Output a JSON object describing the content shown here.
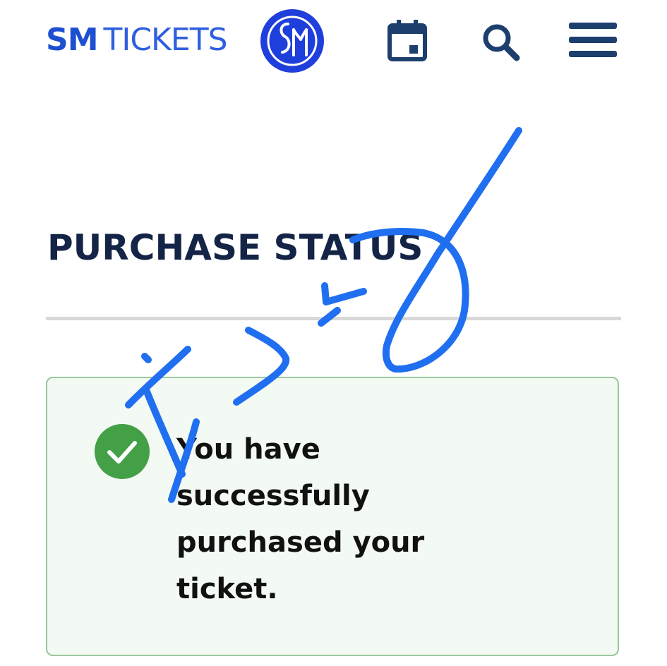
{
  "header": {
    "brand_bold": "SM",
    "brand_light": "TICKETS",
    "logo_icon": "sm-circle-logo",
    "calendar_icon": "calendar-icon",
    "search_icon": "search-icon",
    "menu_icon": "hamburger-menu-icon",
    "brand_color": "#1e4fd1",
    "icon_color": "#1d3f6e"
  },
  "main": {
    "title": "PURCHASE STATUS",
    "status": {
      "icon": "check-circle-icon",
      "message": "You have successfully purchased your ticket.",
      "success_color": "#43a047"
    }
  },
  "annotation": {
    "color": "#1f6ff0"
  }
}
